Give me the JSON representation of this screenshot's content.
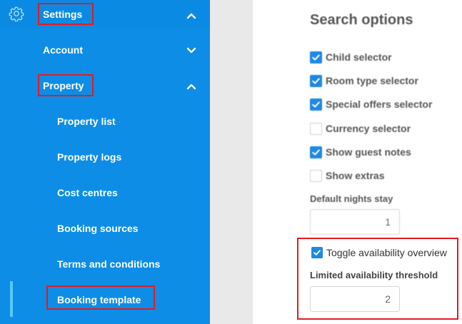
{
  "sidebar": {
    "settings_label": "Settings",
    "account_label": "Account",
    "property_label": "Property",
    "items": [
      {
        "label": "Property list"
      },
      {
        "label": "Property logs"
      },
      {
        "label": "Cost centres"
      },
      {
        "label": "Booking sources"
      },
      {
        "label": "Terms and conditions"
      },
      {
        "label": "Booking template"
      }
    ],
    "active_item": "Booking template",
    "icons": [
      "gear-icon",
      "chevron-up-icon",
      "chevron-down-icon"
    ]
  },
  "panel": {
    "title": "Search options",
    "options": [
      {
        "label": "Child selector",
        "checked": true
      },
      {
        "label": "Room type selector",
        "checked": true
      },
      {
        "label": "Special offers selector",
        "checked": true
      },
      {
        "label": "Currency selector",
        "checked": false
      },
      {
        "label": "Show guest notes",
        "checked": true
      },
      {
        "label": "Show extras",
        "checked": false
      }
    ],
    "default_nights_label": "Default nights stay",
    "default_nights_value": "1",
    "toggle_availability_label": "Toggle availability overview",
    "toggle_availability_checked": true,
    "limited_threshold_label": "Limited availability threshold",
    "limited_threshold_value": "2"
  },
  "colors": {
    "sidebar": "#0d8de6",
    "checkbox": "#1e88e5",
    "annotation": "#e31b23",
    "active_indicator": "#58c9f5"
  }
}
